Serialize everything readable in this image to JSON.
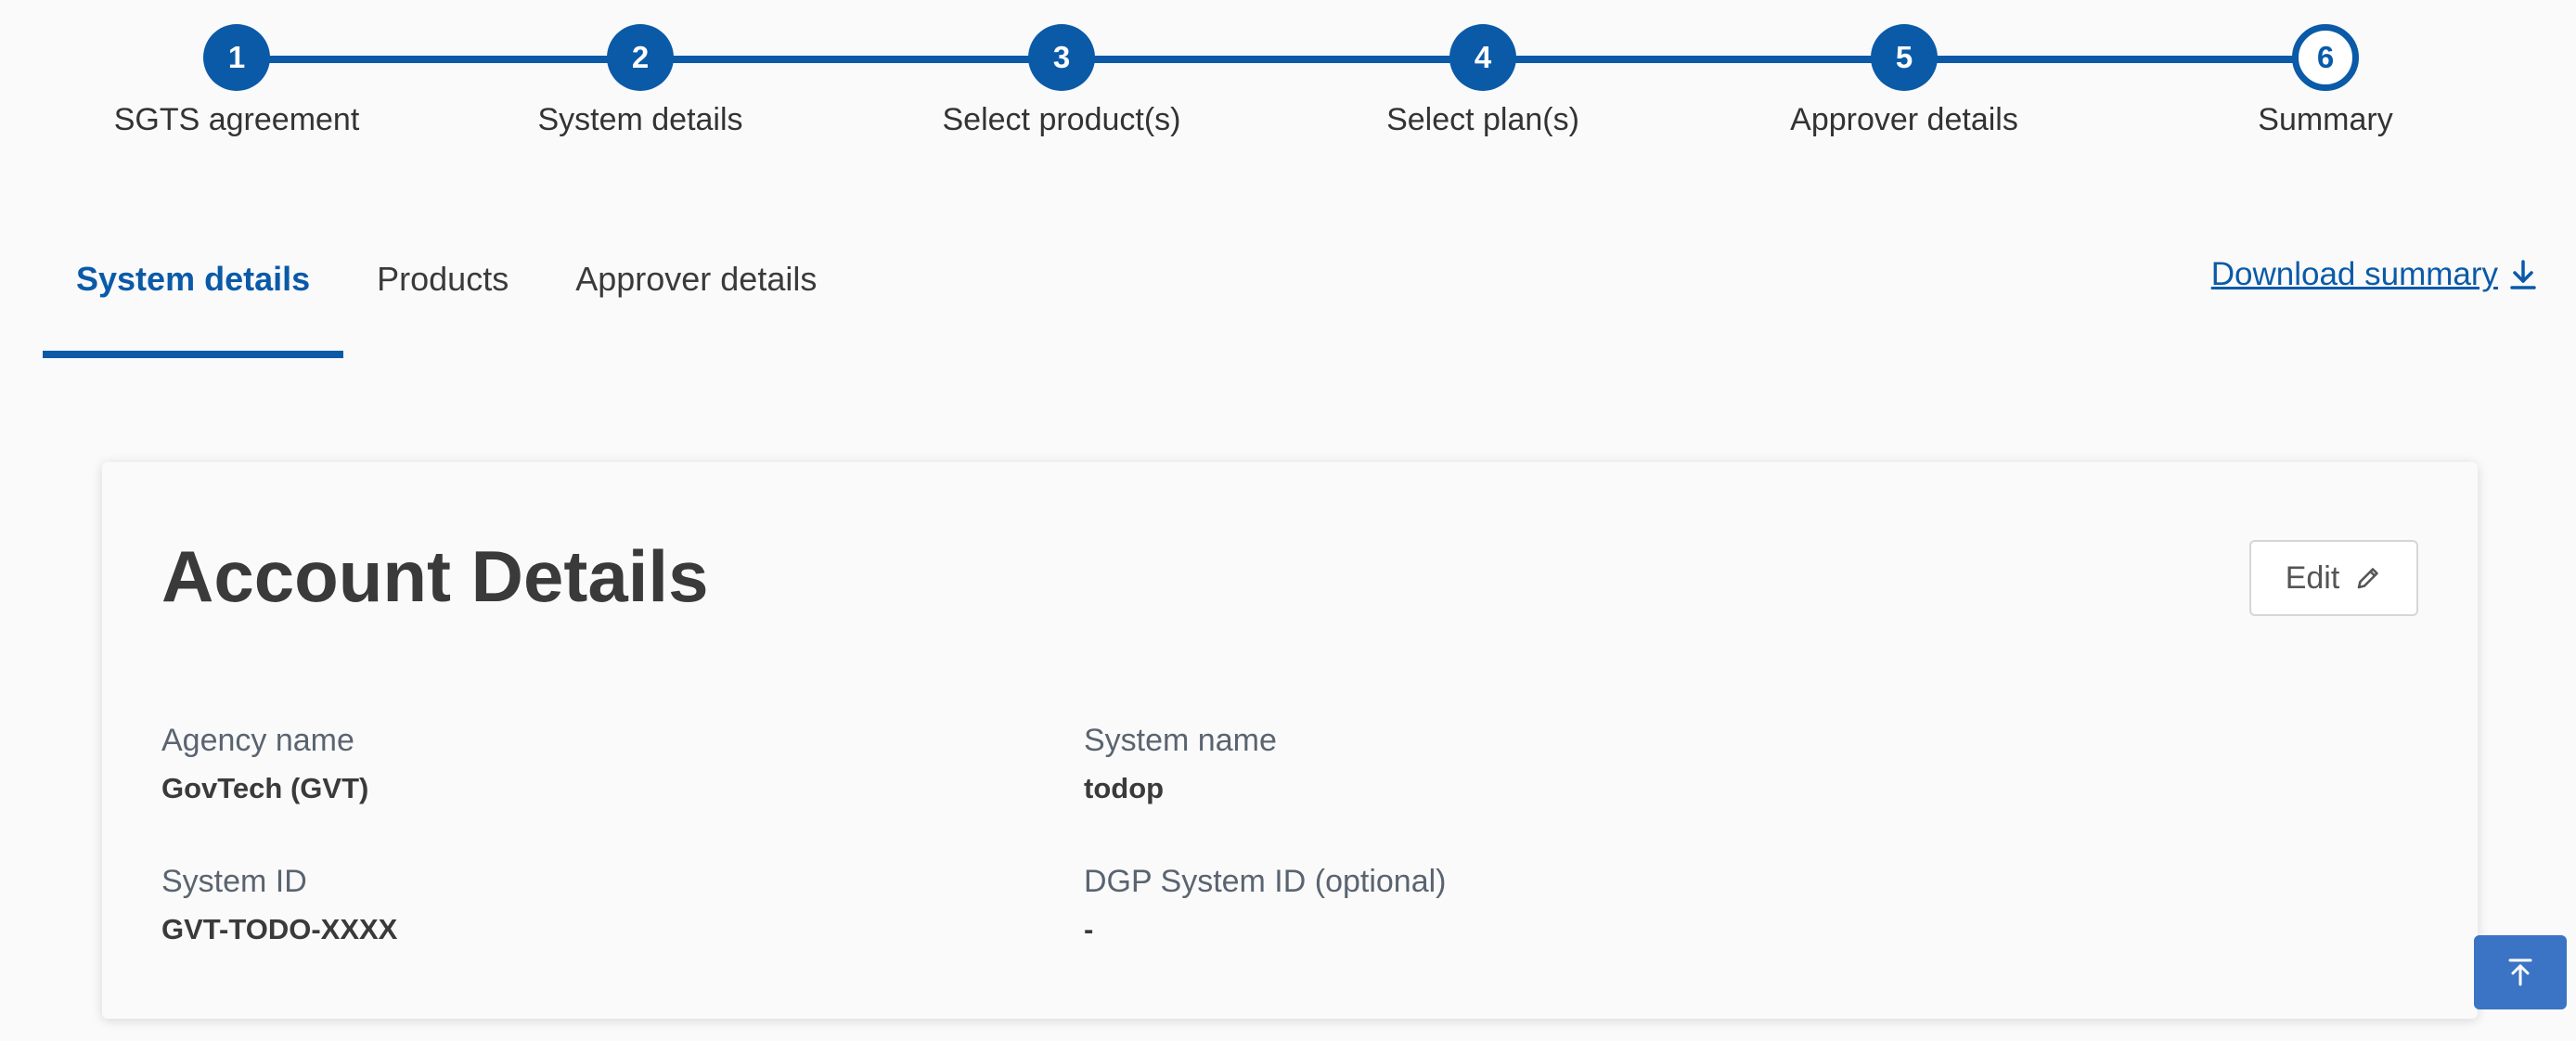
{
  "stepper": {
    "steps": [
      {
        "number": "1",
        "label": "SGTS agreement"
      },
      {
        "number": "2",
        "label": "System details"
      },
      {
        "number": "3",
        "label": "Select product(s)"
      },
      {
        "number": "4",
        "label": "Select plan(s)"
      },
      {
        "number": "5",
        "label": "Approver details"
      },
      {
        "number": "6",
        "label": "Summary"
      }
    ],
    "current_step": "6"
  },
  "tabs": [
    {
      "label": "System details",
      "active": true
    },
    {
      "label": "Products",
      "active": false
    },
    {
      "label": "Approver details",
      "active": false
    }
  ],
  "download": {
    "label": "Download summary",
    "icon": "download-icon"
  },
  "card": {
    "title": "Account Details",
    "edit_label": "Edit",
    "edit_icon": "pencil-icon",
    "fields": {
      "agency_name": {
        "label": "Agency name",
        "value": "GovTech (GVT)"
      },
      "system_name": {
        "label": "System name",
        "value": "todop"
      },
      "system_id": {
        "label": "System ID",
        "value": "GVT-TODO-XXXX"
      },
      "dgp_system_id": {
        "label": "DGP System ID (optional)",
        "value": "-"
      }
    }
  },
  "back_to_top": {
    "icon": "arrow-up-to-line-icon"
  },
  "colors": {
    "primary": "#0a5aa8",
    "back_to_top": "#3b73c5",
    "background": "#fafafa"
  }
}
